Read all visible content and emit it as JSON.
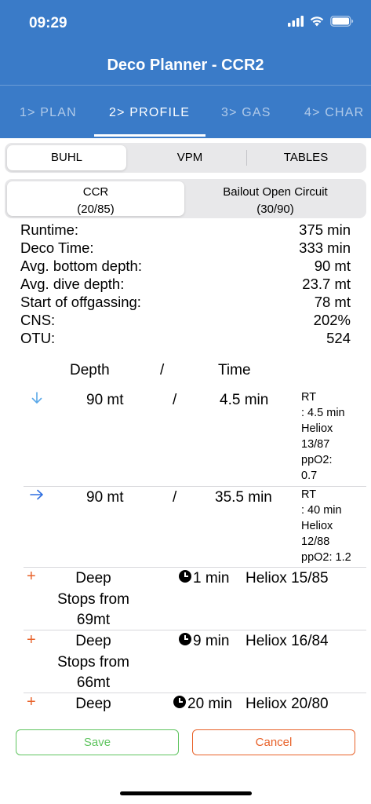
{
  "status": {
    "time": "09:29"
  },
  "nav": {
    "title": "Deco Planner - CCR2"
  },
  "tabs": [
    {
      "label": "1> PLAN"
    },
    {
      "label": "2> PROFILE"
    },
    {
      "label": "3> GAS"
    },
    {
      "label": "4> CHAR"
    }
  ],
  "algorithm": {
    "options": [
      "BUHL",
      "VPM",
      "TABLES"
    ],
    "selected": "BUHL"
  },
  "mode": {
    "options": [
      {
        "label": "CCR",
        "sub": "(20/85)"
      },
      {
        "label": "Bailout Open Circuit",
        "sub": "(30/90)"
      }
    ],
    "selected": "CCR"
  },
  "stats": [
    {
      "label": "Runtime:",
      "value": "375 min"
    },
    {
      "label": "Deco Time:",
      "value": "333 min"
    },
    {
      "label": "Avg. bottom depth:",
      "value": "90 mt"
    },
    {
      "label": "Avg. dive depth:",
      "value": "23.7 mt"
    },
    {
      "label": "Start of offgassing:",
      "value": "78 mt"
    },
    {
      "label": "CNS:",
      "value": "202%"
    },
    {
      "label": "OTU:",
      "value": "524"
    }
  ],
  "table_header": {
    "depth": "Depth",
    "sep": "/",
    "time": "Time"
  },
  "segments": [
    {
      "icon": "arrow-down-icon",
      "depth": "90 mt",
      "sep": "/",
      "time": "4.5 min",
      "info": [
        "RT",
        ": 4.5 min",
        "Heliox",
        "13/87",
        "ppO2:",
        "0.7"
      ]
    },
    {
      "icon": "arrow-right-icon",
      "depth": "90 mt",
      "sep": "/",
      "time": "35.5 min",
      "info": [
        "RT",
        ": 40 min",
        "Heliox",
        "12/88",
        "ppO2: 1.2"
      ]
    }
  ],
  "deco_stops": [
    {
      "name": [
        "Deep",
        "Stops from",
        "69mt"
      ],
      "time": "1 min",
      "gas": "Heliox 15/85"
    },
    {
      "name": [
        "Deep",
        "Stops from",
        "66mt"
      ],
      "time": "9 min",
      "gas": "Heliox 16/84"
    },
    {
      "name": [
        "Deep"
      ],
      "time": "20 min",
      "gas": "Heliox 20/80"
    }
  ],
  "actions": {
    "save": "Save",
    "cancel": "Cancel"
  },
  "colors": {
    "header": "#3a7bc8",
    "save": "#5fc45f",
    "cancel": "#e8622a",
    "arrow_down": "#5aa8e8",
    "arrow_right": "#2f6fe0"
  }
}
